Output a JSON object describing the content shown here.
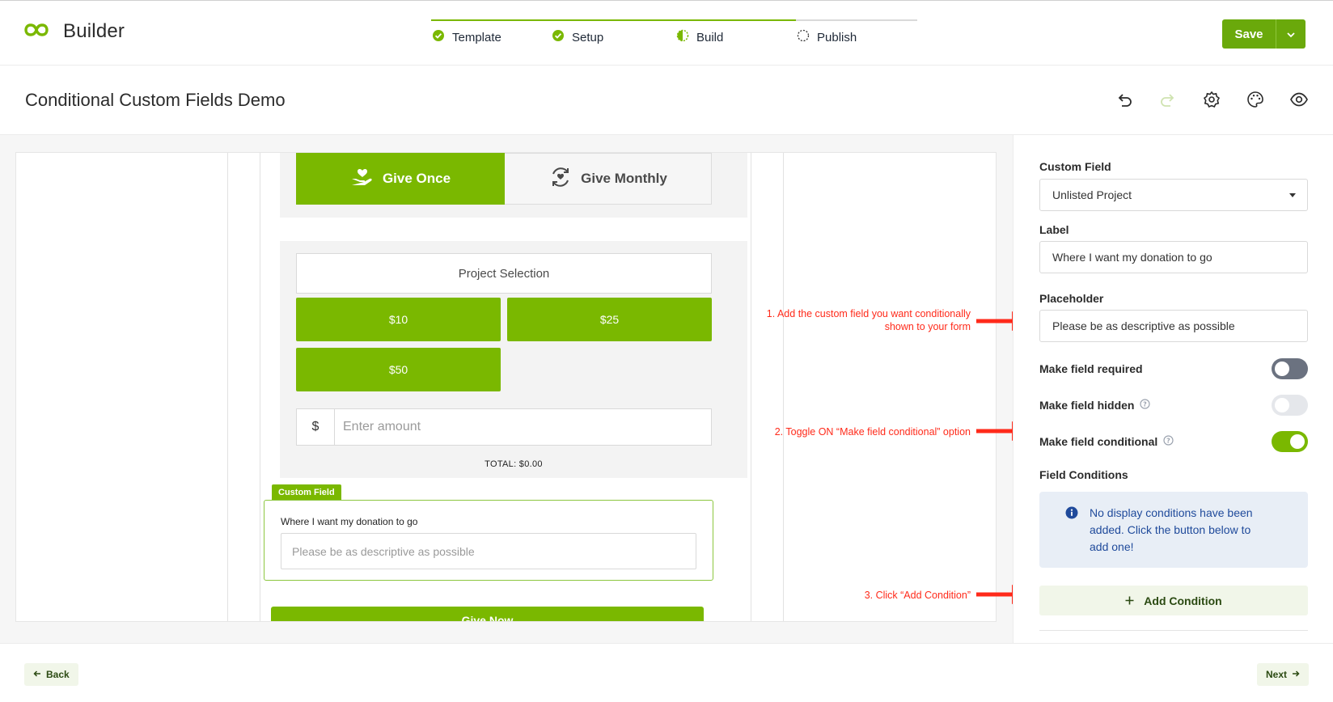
{
  "app": {
    "title": "Builder"
  },
  "steps": [
    {
      "label": "Template",
      "state": "done"
    },
    {
      "label": "Setup",
      "state": "done"
    },
    {
      "label": "Build",
      "state": "current"
    },
    {
      "label": "Publish",
      "state": "pending"
    }
  ],
  "header": {
    "save_label": "Save",
    "page_title": "Conditional Custom Fields Demo"
  },
  "form": {
    "tab_once": "Give Once",
    "tab_monthly": "Give Monthly",
    "project_selection": "Project Selection",
    "amounts": [
      "$10",
      "$25",
      "$50"
    ],
    "currency_symbol": "$",
    "amount_placeholder": "Enter amount",
    "total": "TOTAL: $0.00",
    "custom_field_badge": "Custom Field",
    "custom_field_label": "Where I want my donation to go",
    "custom_field_placeholder": "Please be as descriptive as possible",
    "give_now": "Give Now"
  },
  "annotations": {
    "step1_line1": "1. Add the custom field you want conditionally",
    "step1_line2": "shown to your form",
    "step2": "2. Toggle ON “Make field conditional” option",
    "step3": "3. Click “Add Condition”"
  },
  "panel": {
    "custom_field_label": "Custom Field",
    "custom_field_value": "Unlisted Project",
    "label_label": "Label",
    "label_value": "Where I want my donation to go",
    "placeholder_label": "Placeholder",
    "placeholder_value": "Please be as descriptive as possible",
    "toggles": [
      {
        "label": "Make field required",
        "on": false,
        "enabled": true
      },
      {
        "label": "Make field hidden",
        "on": false,
        "enabled": false
      },
      {
        "label": "Make field conditional",
        "on": true,
        "enabled": true
      }
    ],
    "field_conditions_label": "Field Conditions",
    "info_text": "No display conditions have been added. Click the button below to add one!",
    "add_condition": "Add Condition"
  },
  "footer": {
    "back": "Back",
    "next": "Next"
  },
  "colors": {
    "brand_green": "#7ab800",
    "annotation_red": "#ff2a1a",
    "info_blue": "#1f4a9b"
  }
}
